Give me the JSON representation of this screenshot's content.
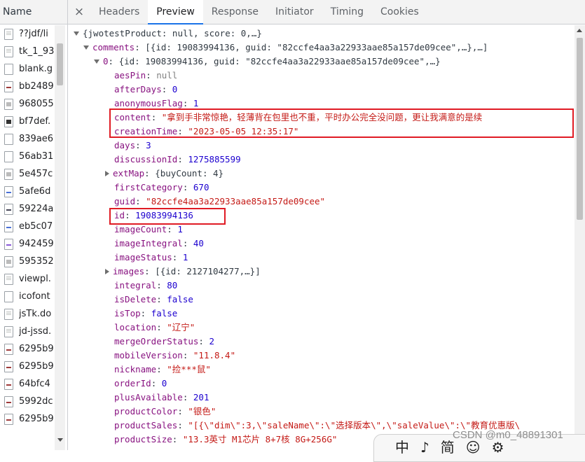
{
  "left_panel": {
    "header": "Name",
    "files": [
      {
        "name": "??jdf/li",
        "icon": "doc"
      },
      {
        "name": "tk_1_93",
        "icon": "doc"
      },
      {
        "name": "blank.g",
        "icon": "blank"
      },
      {
        "name": "bb2489",
        "icon": "img"
      },
      {
        "name": "968055",
        "icon": "grey"
      },
      {
        "name": "bf7def.",
        "icon": "dark"
      },
      {
        "name": "839ae6",
        "icon": "blank"
      },
      {
        "name": "56ab31",
        "icon": "blank"
      },
      {
        "name": "5e457c",
        "icon": "grey"
      },
      {
        "name": "5afe6d",
        "icon": "blue"
      },
      {
        "name": "59224a",
        "icon": "green"
      },
      {
        "name": "eb5c07",
        "icon": "blue"
      },
      {
        "name": "942459",
        "icon": "purple"
      },
      {
        "name": "595352",
        "icon": "grey"
      },
      {
        "name": "viewpl.",
        "icon": "doc"
      },
      {
        "name": "icofont",
        "icon": "blank"
      },
      {
        "name": "jsTk.do",
        "icon": "doc"
      },
      {
        "name": "jd-jssd.",
        "icon": "doc"
      },
      {
        "name": "6295b9",
        "icon": "img"
      },
      {
        "name": "6295b9",
        "icon": "img"
      },
      {
        "name": "64bfc4",
        "icon": "img"
      },
      {
        "name": "5992dc",
        "icon": "img"
      },
      {
        "name": "6295b9",
        "icon": "img"
      }
    ]
  },
  "tabs": {
    "close": "×",
    "items": [
      "Headers",
      "Preview",
      "Response",
      "Initiator",
      "Timing",
      "Cookies"
    ],
    "active": "Preview"
  },
  "preview": {
    "root": "{jwotestProduct: null, score: 0,…}",
    "comments_key": "comments",
    "comments_val": "[{id: 19083994136, guid: \"82ccfe4aa3a22933aae85a157de09cee\",…},…]",
    "item0_key": "0",
    "item0_val": "{id: 19083994136, guid: \"82ccfe4aa3a22933aae85a157de09cee\",…}",
    "props": [
      {
        "key": "aesPin",
        "value": "null",
        "type": "null"
      },
      {
        "key": "afterDays",
        "value": "0",
        "type": "num"
      },
      {
        "key": "anonymousFlag",
        "value": "1",
        "type": "num"
      },
      {
        "key": "content",
        "value": "\"拿到手非常惊艳，轻薄背在包里也不重，平时办公完全没问题，更让我满意的是续",
        "type": "str"
      },
      {
        "key": "creationTime",
        "value": "\"2023-05-05 12:35:17\"",
        "type": "str"
      },
      {
        "key": "days",
        "value": "3",
        "type": "num"
      },
      {
        "key": "discussionId",
        "value": "1275885599",
        "type": "num"
      },
      {
        "key": "extMap",
        "value": "{buyCount: 4}",
        "type": "obj",
        "collapsed": true
      },
      {
        "key": "firstCategory",
        "value": "670",
        "type": "num"
      },
      {
        "key": "guid",
        "value": "\"82ccfe4aa3a22933aae85a157de09cee\"",
        "type": "str"
      },
      {
        "key": "id",
        "value": "19083994136",
        "type": "num"
      },
      {
        "key": "imageCount",
        "value": "1",
        "type": "num"
      },
      {
        "key": "imageIntegral",
        "value": "40",
        "type": "num"
      },
      {
        "key": "imageStatus",
        "value": "1",
        "type": "num"
      },
      {
        "key": "images",
        "value": "[{id: 2127104277,…}]",
        "type": "obj",
        "collapsed": true
      },
      {
        "key": "integral",
        "value": "80",
        "type": "num"
      },
      {
        "key": "isDelete",
        "value": "false",
        "type": "num"
      },
      {
        "key": "isTop",
        "value": "false",
        "type": "num"
      },
      {
        "key": "location",
        "value": "\"辽宁\"",
        "type": "str"
      },
      {
        "key": "mergeOrderStatus",
        "value": "2",
        "type": "num"
      },
      {
        "key": "mobileVersion",
        "value": "\"11.8.4\"",
        "type": "str"
      },
      {
        "key": "nickname",
        "value": "\"捡***鼠\"",
        "type": "str"
      },
      {
        "key": "orderId",
        "value": "0",
        "type": "num"
      },
      {
        "key": "plusAvailable",
        "value": "201",
        "type": "num"
      },
      {
        "key": "productColor",
        "value": "\"银色\"",
        "type": "str"
      },
      {
        "key": "productSales",
        "value": "\"[{\\\"dim\\\":3,\\\"saleName\\\":\\\"选择版本\\\",\\\"saleValue\\\":\\\"教育优惠版\\",
        "type": "str"
      },
      {
        "key": "productSize",
        "value": "\"13.3英寸 M1芯片 8+7核 8G+256G\"",
        "type": "str"
      }
    ]
  },
  "watermark": "CSDN @m0_48891301",
  "ime": [
    "中",
    "♪",
    "简",
    "☺",
    "⚙"
  ],
  "colors": {
    "highlight": "#e01b24",
    "active_tab": "#1a73e8",
    "key": "#881280",
    "string": "#c41a16",
    "number": "#1c00cf"
  }
}
